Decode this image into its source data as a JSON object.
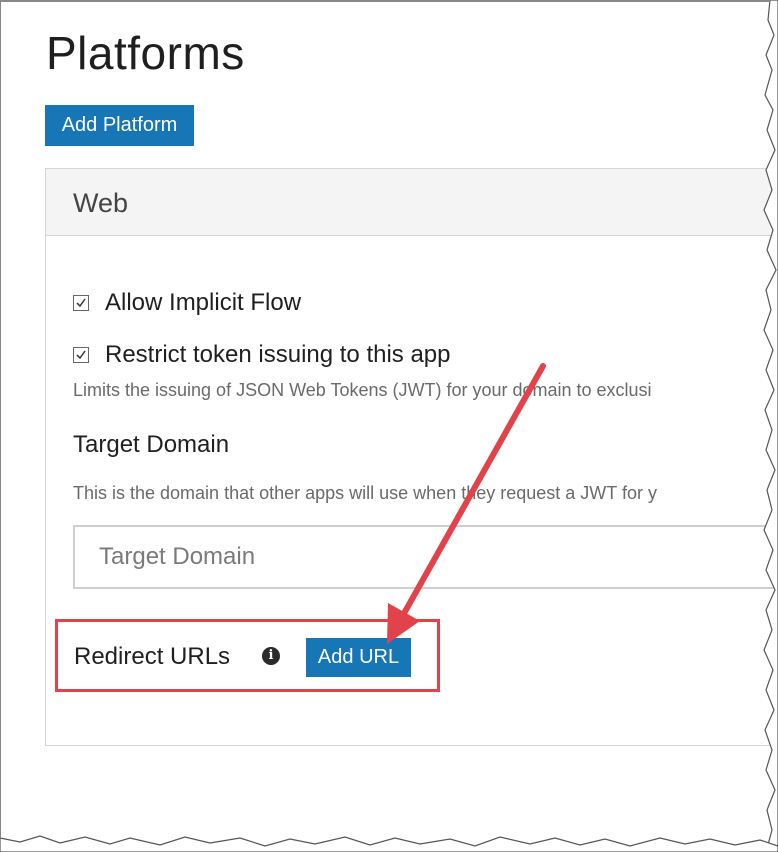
{
  "page": {
    "title": "Platforms",
    "add_platform_label": "Add Platform"
  },
  "web_panel": {
    "header": "Web",
    "allow_implicit_flow": {
      "label": "Allow Implicit Flow",
      "checked": true
    },
    "restrict_token": {
      "label": "Restrict token issuing to this app",
      "checked": true,
      "hint": "Limits the issuing of JSON Web Tokens (JWT) for your domain to exclusi"
    },
    "target_domain": {
      "title": "Target Domain",
      "hint": "This is the domain that other apps will use when they request a JWT for y",
      "placeholder": "Target Domain",
      "value": ""
    },
    "redirect_urls": {
      "label": "Redirect URLs",
      "info_icon": "info-icon",
      "add_url_label": "Add URL"
    }
  },
  "annotation": {
    "arrow_color": "#e2434a",
    "highlight_color": "#e2434a"
  },
  "colors": {
    "accent": "#1776b5"
  }
}
